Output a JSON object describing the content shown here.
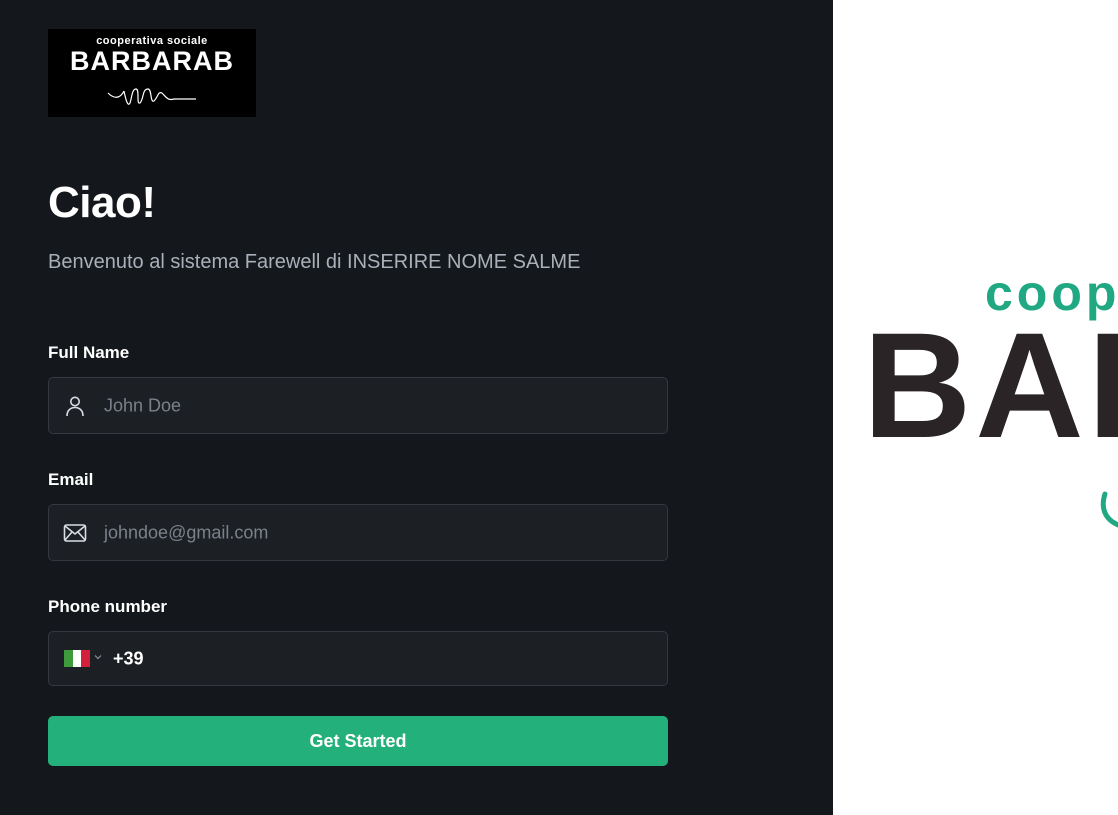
{
  "logo": {
    "tagline": "cooperativa sociale",
    "name": "BARBARAB"
  },
  "hero": {
    "title": "Ciao!",
    "subtitle": "Benvenuto al sistema Farewell di INSERIRE NOME SALME"
  },
  "form": {
    "full_name": {
      "label": "Full Name",
      "placeholder": "John Doe",
      "icon": "user-icon"
    },
    "email": {
      "label": "Email",
      "placeholder": "johndoe@gmail.com",
      "icon": "mail-icon"
    },
    "phone": {
      "label": "Phone number",
      "country_flag": "italy-flag-icon",
      "dial_code": "+39"
    },
    "submit_label": "Get Started"
  },
  "side_banner": {
    "tagline_visible": "coop",
    "name_visible": "BAR"
  },
  "colors": {
    "left_bg": "#14171b",
    "field_bg": "#1c1f24",
    "accent": "#24b07a",
    "brand_green": "#1fa882",
    "brand_dark": "#2a2426"
  }
}
